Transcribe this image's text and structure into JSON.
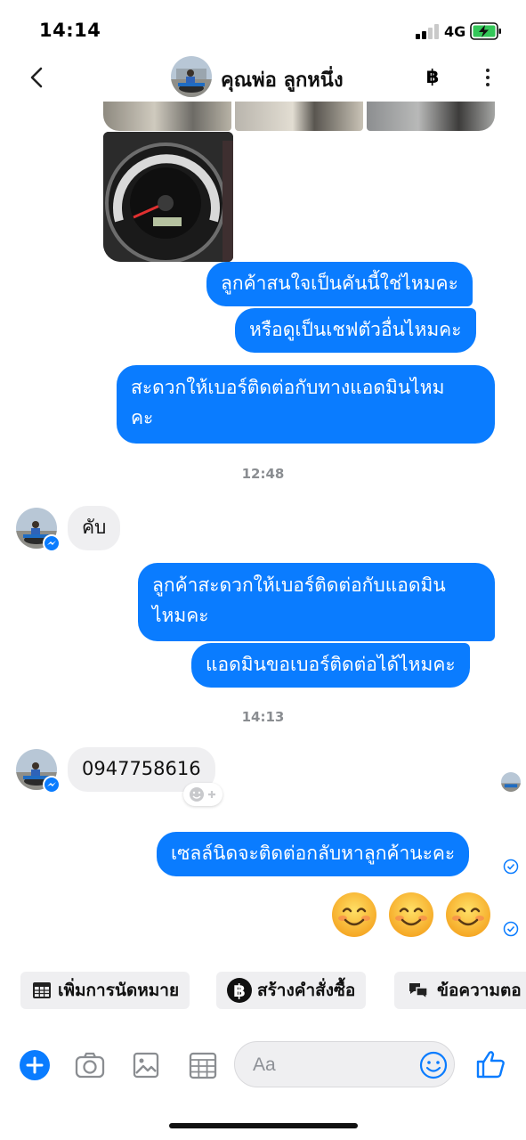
{
  "status_bar": {
    "time": "14:14",
    "network": "4G"
  },
  "header": {
    "contact_name": "คุณพ่อ ลูกหนึ่ง",
    "currency_symbol": "฿"
  },
  "messages": {
    "out_1": "ลูกค้าสนใจเป็นคันนี้ใช่ไหมคะ",
    "out_2": "หรือดูเป็นเชฟตัวอื่นไหมคะ",
    "out_3_line1": "สะดวกให้เบอร์ติดต่อกับทางแอดมินไหม",
    "out_3_line2": "คะ",
    "time_1": "12:48",
    "in_1": "คับ",
    "out_4_line1": "ลูกค้าสะดวกให้เบอร์ติดต่อกับแอดมิน",
    "out_4_line2": "ไหมคะ",
    "out_5": "แอดมินขอเบอร์ติดต่อได้ไหมคะ",
    "time_2": "14:13",
    "in_2": "0947758616",
    "out_6": "เซลล์นิดจะติดต่อกลับหาลูกค้านะคะ",
    "emojis": [
      "😊",
      "😊",
      "😊"
    ]
  },
  "quick_actions": [
    {
      "label": "เพิ่มการนัดหมาย",
      "icon": "calendar-icon"
    },
    {
      "label": "สร้างคำสั่งซื้อ",
      "icon": "baht-icon"
    },
    {
      "label": "ข้อความตอ",
      "icon": "chat-bubbles-icon"
    }
  ],
  "composer": {
    "placeholder": "Aa"
  },
  "colors": {
    "accent": "#0a7cff",
    "incoming_bubble": "#efeff1",
    "timestamp": "#8a8d91"
  }
}
